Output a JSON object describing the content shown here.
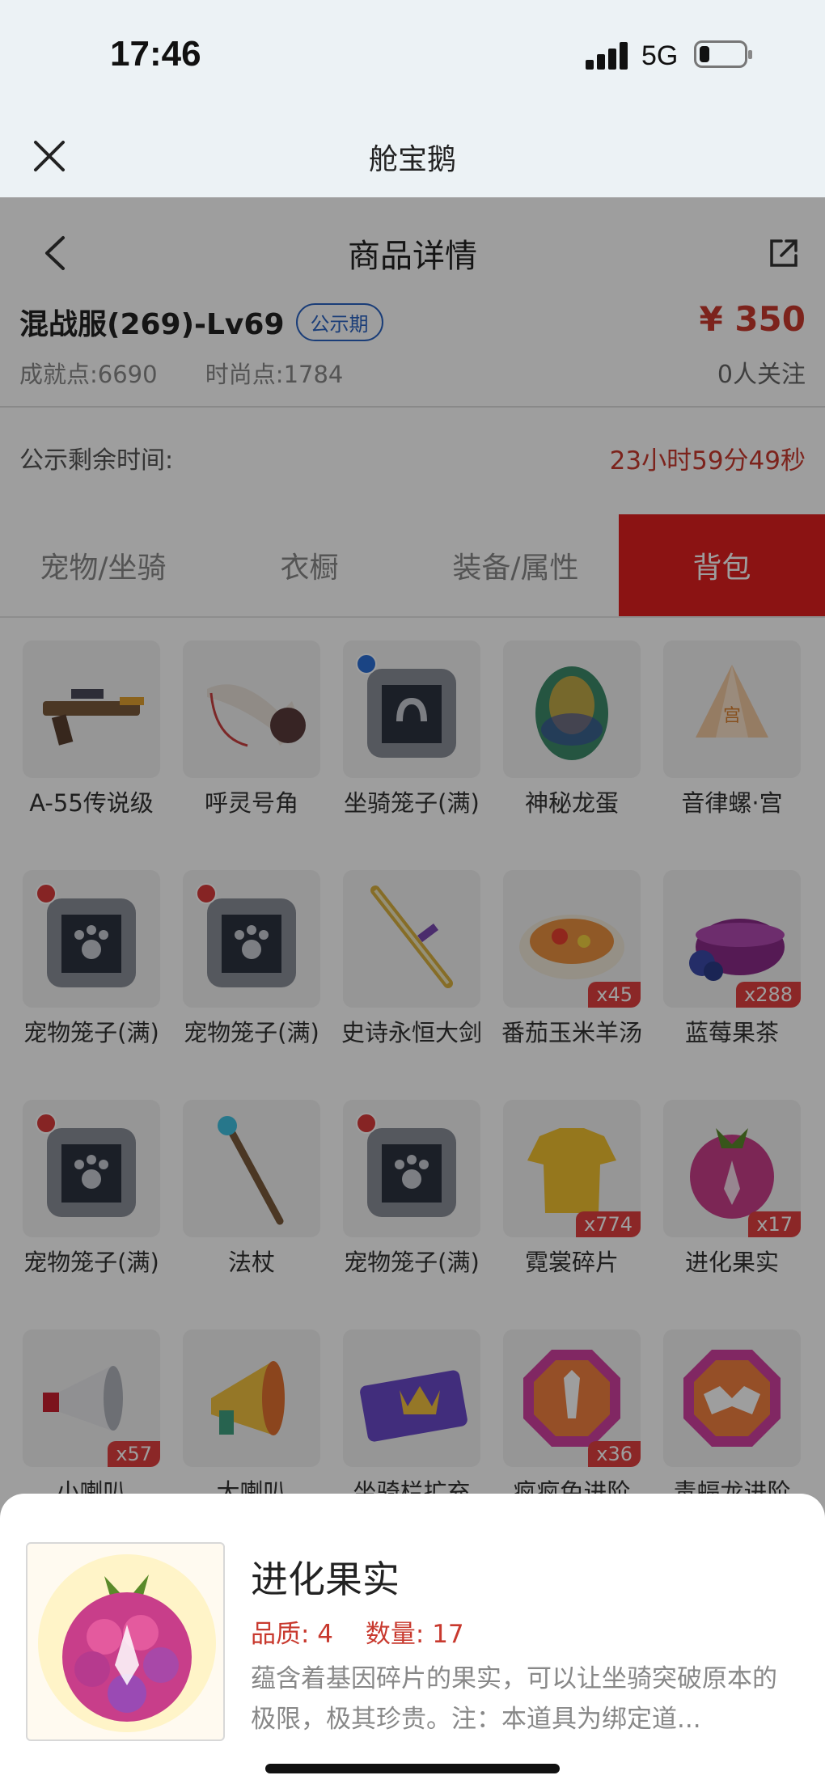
{
  "status_bar": {
    "time": "17:46",
    "network": "5G"
  },
  "webview": {
    "title": "舱宝鹅"
  },
  "nav": {
    "title": "商品详情"
  },
  "product": {
    "server": "混战服(269)-Lv69",
    "badge": "公示期",
    "price": "¥ 350",
    "achievement": "成就点:6690",
    "fashion": "时尚点:1784",
    "followers": "0人关注",
    "timer_label": "公示剩余时间:",
    "timer_value": "23小时59分49秒"
  },
  "tabs": [
    {
      "label": "宠物/坐骑",
      "active": false
    },
    {
      "label": "衣橱",
      "active": false
    },
    {
      "label": "装备/属性",
      "active": false
    },
    {
      "label": "背包",
      "active": true
    }
  ],
  "items": [
    {
      "name": "A-55传说级",
      "qty": "",
      "icon": "rifle-icon"
    },
    {
      "name": "呼灵号角",
      "qty": "",
      "icon": "horn-icon"
    },
    {
      "name": "坐骑笼子(满)",
      "qty": "",
      "icon": "mount-cage-icon"
    },
    {
      "name": "神秘龙蛋",
      "qty": "",
      "icon": "dragon-egg-icon"
    },
    {
      "name": "音律螺·宫",
      "qty": "",
      "icon": "conch-icon"
    },
    {
      "name": "宠物笼子(满)",
      "qty": "",
      "icon": "pet-cage-icon"
    },
    {
      "name": "宠物笼子(满)",
      "qty": "",
      "icon": "pet-cage-icon"
    },
    {
      "name": "史诗永恒大剑",
      "qty": "",
      "icon": "sword-icon"
    },
    {
      "name": "番茄玉米羊汤",
      "qty": "x45",
      "icon": "soup-icon"
    },
    {
      "name": "蓝莓果茶",
      "qty": "x288",
      "icon": "tea-icon"
    },
    {
      "name": "宠物笼子(满)",
      "qty": "",
      "icon": "pet-cage-icon"
    },
    {
      "name": "法杖",
      "qty": "",
      "icon": "staff-icon"
    },
    {
      "name": "宠物笼子(满)",
      "qty": "",
      "icon": "pet-cage-icon"
    },
    {
      "name": "霓裳碎片",
      "qty": "x774",
      "icon": "shirt-icon"
    },
    {
      "name": "进化果实",
      "qty": "x17",
      "icon": "evolution-fruit-icon"
    },
    {
      "name": "小喇叭",
      "qty": "x57",
      "icon": "small-horn-icon"
    },
    {
      "name": "大喇叭",
      "qty": "",
      "icon": "big-horn-icon"
    },
    {
      "name": "坐骑栏扩充",
      "qty": "",
      "icon": "ticket-icon"
    },
    {
      "name": "疯疯兔进阶",
      "qty": "x36",
      "icon": "rabbit-gem-icon"
    },
    {
      "name": "毒蝠龙进阶",
      "qty": "",
      "icon": "bat-gem-icon"
    }
  ],
  "detail": {
    "name": "进化果实",
    "quality": "品质: 4",
    "count": "数量: 17",
    "description": "蕴含着基因碎片的果实，可以让坐骑突破原本的极限，极其珍贵。注：本道具为绑定道..."
  }
}
